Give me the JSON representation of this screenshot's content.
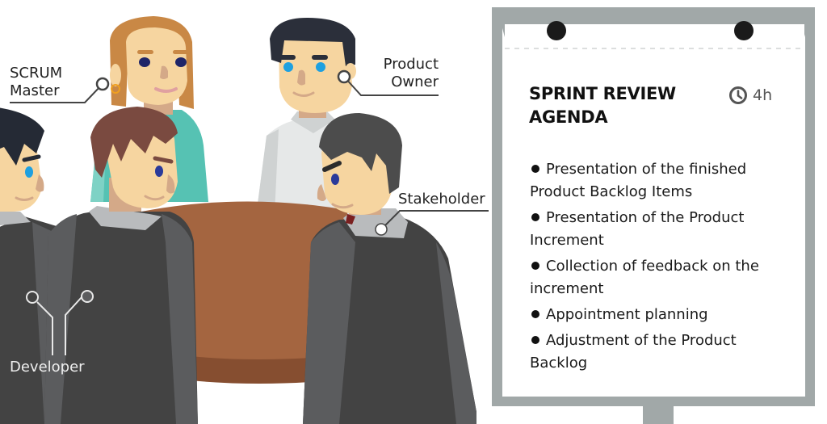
{
  "scene": {
    "title": "Sprint Review meeting illustration",
    "colors": {
      "board_frame": "#a1a8a8",
      "board_paper": "#ffffff",
      "table_top": "#a46540",
      "table_edge": "#864e30",
      "jacket_dark": "#434343",
      "jacket_light": "#5b5c5e",
      "collar": "#b9bbbd",
      "skin": "#f6d5a0",
      "skin_shadow": "#d4a988",
      "teal_shirt": "#56c2b3",
      "white_shirt": "#e6e8e8",
      "hair_auburn": "#c98845",
      "hair_brown": "#7a4a40",
      "hair_black": "#2b2f3a",
      "hair_grey": "#4c4c4c",
      "eye_blue": "#1ea0e0",
      "eye_navy": "#2a3a9a",
      "label_line": "#444444"
    }
  },
  "roles": {
    "scrum_master": {
      "line1": "SCRUM",
      "line2": "Master"
    },
    "product_owner": {
      "line1": "Product",
      "line2": "Owner"
    },
    "stakeholder": {
      "label": "Stakeholder"
    },
    "developer": {
      "label": "Developer"
    }
  },
  "board": {
    "title_line1": "SPRINT REVIEW",
    "title_line2": "AGENDA",
    "duration_icon": "clock-icon",
    "duration": "4h",
    "agenda": [
      "Presentation of the finished Product Backlog Items",
      "Presentation of the Product Increment",
      "Collection of feedback on the increment",
      "Appointment planning",
      "Adjustment of  the Product Backlog"
    ]
  }
}
